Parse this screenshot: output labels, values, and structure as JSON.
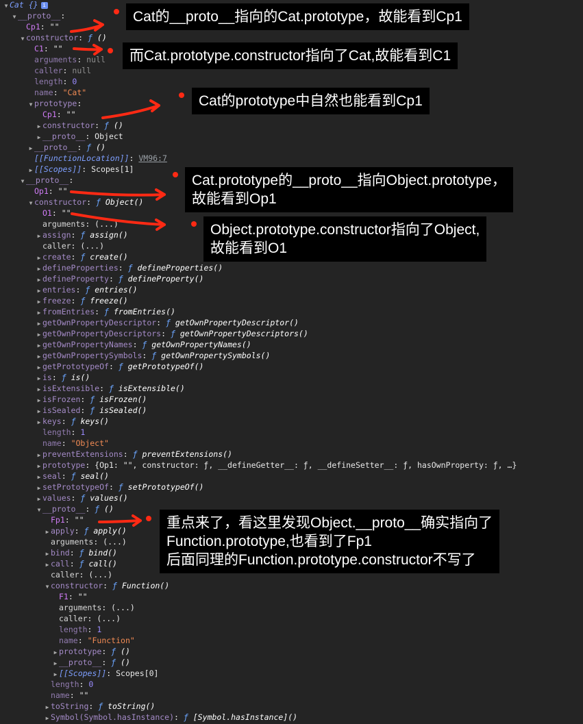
{
  "tree": [
    {
      "lvl": 0,
      "tri": "open",
      "key": "Cat {}",
      "kc": "k-int",
      "info": "i"
    },
    {
      "lvl": 1,
      "tri": "open",
      "key": "__proto__",
      "kc": "k-inh"
    },
    {
      "lvl": 2,
      "tri": "",
      "key": "Cp1",
      "kc": "k-own",
      "val": "\"\"",
      "vc": "v-plain"
    },
    {
      "lvl": 2,
      "tri": "open",
      "key": "constructor",
      "kc": "k-inh",
      "vf": "ƒ",
      "val": "()",
      "vc": "v-fn"
    },
    {
      "lvl": 3,
      "tri": "",
      "key": "C1",
      "kc": "k-own",
      "val": "\"\"",
      "vc": "v-plain"
    },
    {
      "lvl": 3,
      "tri": "",
      "key": "arguments",
      "kc": "k-faint",
      "val": "null",
      "vc": "v-null"
    },
    {
      "lvl": 3,
      "tri": "",
      "key": "caller",
      "kc": "k-faint",
      "val": "null",
      "vc": "v-null"
    },
    {
      "lvl": 3,
      "tri": "",
      "key": "length",
      "kc": "k-faint",
      "val": "0",
      "vc": "v-num"
    },
    {
      "lvl": 3,
      "tri": "",
      "key": "name",
      "kc": "k-faint",
      "val": "\"Cat\"",
      "vc": "v-str"
    },
    {
      "lvl": 3,
      "tri": "open",
      "key": "prototype",
      "kc": "k-inh"
    },
    {
      "lvl": 4,
      "tri": "",
      "key": "Cp1",
      "kc": "k-own",
      "val": "\"\"",
      "vc": "v-plain"
    },
    {
      "lvl": 4,
      "tri": "closed",
      "key": "constructor",
      "kc": "k-inh",
      "vf": "ƒ",
      "val": "()",
      "vc": "v-fn"
    },
    {
      "lvl": 4,
      "tri": "closed",
      "key": "__proto__",
      "kc": "k-inh",
      "val": "Object",
      "vc": "v-plain"
    },
    {
      "lvl": 3,
      "tri": "closed",
      "key": "__proto__",
      "kc": "k-inh",
      "vf": "ƒ",
      "val": "()",
      "vc": "v-fn"
    },
    {
      "lvl": 3,
      "tri": "",
      "key": "[[FunctionLocation]]",
      "kc": "k-int",
      "val": "VM96:7",
      "vc": "v-link"
    },
    {
      "lvl": 3,
      "tri": "closed",
      "key": "[[Scopes]]",
      "kc": "k-int",
      "val": "Scopes[1]",
      "vc": "v-plain"
    },
    {
      "lvl": 2,
      "tri": "open",
      "key": "__proto__",
      "kc": "k-inh"
    },
    {
      "lvl": 3,
      "tri": "",
      "key": "Op1",
      "kc": "k-own",
      "val": "\"\"",
      "vc": "v-plain"
    },
    {
      "lvl": 3,
      "tri": "open",
      "key": "constructor",
      "kc": "k-inh",
      "vf": "ƒ",
      "val": "Object()",
      "vc": "v-fn"
    },
    {
      "lvl": 4,
      "tri": "",
      "key": "O1",
      "kc": "k-own",
      "val": "\"\"",
      "vc": "v-plain"
    },
    {
      "lvl": 4,
      "tri": "",
      "key": "arguments",
      "kc": "k-pale",
      "val": "(...)",
      "vc": "v-plain"
    },
    {
      "lvl": 4,
      "tri": "closed",
      "key": "assign",
      "kc": "k-inh",
      "vf": "ƒ",
      "val": "assign()",
      "vc": "v-fn"
    },
    {
      "lvl": 4,
      "tri": "",
      "key": "caller",
      "kc": "k-pale",
      "val": "(...)",
      "vc": "v-plain"
    },
    {
      "lvl": 4,
      "tri": "closed",
      "key": "create",
      "kc": "k-inh",
      "vf": "ƒ",
      "val": "create()",
      "vc": "v-fn"
    },
    {
      "lvl": 4,
      "tri": "closed",
      "key": "defineProperties",
      "kc": "k-inh",
      "vf": "ƒ",
      "val": "defineProperties()",
      "vc": "v-fn"
    },
    {
      "lvl": 4,
      "tri": "closed",
      "key": "defineProperty",
      "kc": "k-inh",
      "vf": "ƒ",
      "val": "defineProperty()",
      "vc": "v-fn"
    },
    {
      "lvl": 4,
      "tri": "closed",
      "key": "entries",
      "kc": "k-inh",
      "vf": "ƒ",
      "val": "entries()",
      "vc": "v-fn"
    },
    {
      "lvl": 4,
      "tri": "closed",
      "key": "freeze",
      "kc": "k-inh",
      "vf": "ƒ",
      "val": "freeze()",
      "vc": "v-fn"
    },
    {
      "lvl": 4,
      "tri": "closed",
      "key": "fromEntries",
      "kc": "k-inh",
      "vf": "ƒ",
      "val": "fromEntries()",
      "vc": "v-fn"
    },
    {
      "lvl": 4,
      "tri": "closed",
      "key": "getOwnPropertyDescriptor",
      "kc": "k-inh",
      "vf": "ƒ",
      "val": "getOwnPropertyDescriptor()",
      "vc": "v-fn"
    },
    {
      "lvl": 4,
      "tri": "closed",
      "key": "getOwnPropertyDescriptors",
      "kc": "k-inh",
      "vf": "ƒ",
      "val": "getOwnPropertyDescriptors()",
      "vc": "v-fn"
    },
    {
      "lvl": 4,
      "tri": "closed",
      "key": "getOwnPropertyNames",
      "kc": "k-inh",
      "vf": "ƒ",
      "val": "getOwnPropertyNames()",
      "vc": "v-fn"
    },
    {
      "lvl": 4,
      "tri": "closed",
      "key": "getOwnPropertySymbols",
      "kc": "k-inh",
      "vf": "ƒ",
      "val": "getOwnPropertySymbols()",
      "vc": "v-fn"
    },
    {
      "lvl": 4,
      "tri": "closed",
      "key": "getPrototypeOf",
      "kc": "k-inh",
      "vf": "ƒ",
      "val": "getPrototypeOf()",
      "vc": "v-fn"
    },
    {
      "lvl": 4,
      "tri": "closed",
      "key": "is",
      "kc": "k-inh",
      "vf": "ƒ",
      "val": "is()",
      "vc": "v-fn"
    },
    {
      "lvl": 4,
      "tri": "closed",
      "key": "isExtensible",
      "kc": "k-inh",
      "vf": "ƒ",
      "val": "isExtensible()",
      "vc": "v-fn"
    },
    {
      "lvl": 4,
      "tri": "closed",
      "key": "isFrozen",
      "kc": "k-inh",
      "vf": "ƒ",
      "val": "isFrozen()",
      "vc": "v-fn"
    },
    {
      "lvl": 4,
      "tri": "closed",
      "key": "isSealed",
      "kc": "k-inh",
      "vf": "ƒ",
      "val": "isSealed()",
      "vc": "v-fn"
    },
    {
      "lvl": 4,
      "tri": "closed",
      "key": "keys",
      "kc": "k-inh",
      "vf": "ƒ",
      "val": "keys()",
      "vc": "v-fn"
    },
    {
      "lvl": 4,
      "tri": "",
      "key": "length",
      "kc": "k-faint",
      "val": "1",
      "vc": "v-num"
    },
    {
      "lvl": 4,
      "tri": "",
      "key": "name",
      "kc": "k-faint",
      "val": "\"Object\"",
      "vc": "v-str"
    },
    {
      "lvl": 4,
      "tri": "closed",
      "key": "preventExtensions",
      "kc": "k-inh",
      "vf": "ƒ",
      "val": "preventExtensions()",
      "vc": "v-fn"
    },
    {
      "lvl": 4,
      "tri": "closed",
      "key": "prototype",
      "kc": "k-inh",
      "val": "{Op1: \"\", constructor: ƒ, __defineGetter__: ƒ, __defineSetter__: ƒ, hasOwnProperty: ƒ, …}",
      "vc": "v-plain"
    },
    {
      "lvl": 4,
      "tri": "closed",
      "key": "seal",
      "kc": "k-inh",
      "vf": "ƒ",
      "val": "seal()",
      "vc": "v-fn"
    },
    {
      "lvl": 4,
      "tri": "closed",
      "key": "setPrototypeOf",
      "kc": "k-inh",
      "vf": "ƒ",
      "val": "setPrototypeOf()",
      "vc": "v-fn"
    },
    {
      "lvl": 4,
      "tri": "closed",
      "key": "values",
      "kc": "k-inh",
      "vf": "ƒ",
      "val": "values()",
      "vc": "v-fn"
    },
    {
      "lvl": 4,
      "tri": "open",
      "key": "__proto__",
      "kc": "k-inh",
      "vf": "ƒ",
      "val": "()",
      "vc": "v-fn"
    },
    {
      "lvl": 5,
      "tri": "",
      "key": "Fp1",
      "kc": "k-own",
      "val": "\"\"",
      "vc": "v-plain"
    },
    {
      "lvl": 5,
      "tri": "closed",
      "key": "apply",
      "kc": "k-inh",
      "vf": "ƒ",
      "val": "apply()",
      "vc": "v-fn"
    },
    {
      "lvl": 5,
      "tri": "",
      "key": "arguments",
      "kc": "k-pale",
      "val": "(...)",
      "vc": "v-plain"
    },
    {
      "lvl": 5,
      "tri": "closed",
      "key": "bind",
      "kc": "k-inh",
      "vf": "ƒ",
      "val": "bind()",
      "vc": "v-fn"
    },
    {
      "lvl": 5,
      "tri": "closed",
      "key": "call",
      "kc": "k-inh",
      "vf": "ƒ",
      "val": "call()",
      "vc": "v-fn"
    },
    {
      "lvl": 5,
      "tri": "",
      "key": "caller",
      "kc": "k-pale",
      "val": "(...)",
      "vc": "v-plain"
    },
    {
      "lvl": 5,
      "tri": "open",
      "key": "constructor",
      "kc": "k-inh",
      "vf": "ƒ",
      "val": "Function()",
      "vc": "v-fn"
    },
    {
      "lvl": 6,
      "tri": "",
      "key": "F1",
      "kc": "k-own",
      "val": "\"\"",
      "vc": "v-plain"
    },
    {
      "lvl": 6,
      "tri": "",
      "key": "arguments",
      "kc": "k-pale",
      "val": "(...)",
      "vc": "v-plain"
    },
    {
      "lvl": 6,
      "tri": "",
      "key": "caller",
      "kc": "k-pale",
      "val": "(...)",
      "vc": "v-plain"
    },
    {
      "lvl": 6,
      "tri": "",
      "key": "length",
      "kc": "k-faint",
      "val": "1",
      "vc": "v-num"
    },
    {
      "lvl": 6,
      "tri": "",
      "key": "name",
      "kc": "k-faint",
      "val": "\"Function\"",
      "vc": "v-str"
    },
    {
      "lvl": 6,
      "tri": "closed",
      "key": "prototype",
      "kc": "k-inh",
      "vf": "ƒ",
      "val": "()",
      "vc": "v-fn"
    },
    {
      "lvl": 6,
      "tri": "closed",
      "key": "__proto__",
      "kc": "k-inh",
      "vf": "ƒ",
      "val": "()",
      "vc": "v-fn"
    },
    {
      "lvl": 6,
      "tri": "closed",
      "key": "[[Scopes]]",
      "kc": "k-int",
      "val": "Scopes[0]",
      "vc": "v-plain"
    },
    {
      "lvl": 5,
      "tri": "",
      "key": "length",
      "kc": "k-faint",
      "val": "0",
      "vc": "v-num"
    },
    {
      "lvl": 5,
      "tri": "",
      "key": "name",
      "kc": "k-faint",
      "val": "\"\"",
      "vc": "v-plain"
    },
    {
      "lvl": 5,
      "tri": "closed",
      "key": "toString",
      "kc": "k-inh",
      "vf": "ƒ",
      "val": "toString()",
      "vc": "v-fn"
    },
    {
      "lvl": 5,
      "tri": "closed",
      "key": "Symbol(Symbol.hasInstance)",
      "kc": "k-inh",
      "vf": "ƒ",
      "val": "[Symbol.hasInstance]()",
      "vc": "v-fn"
    }
  ],
  "notes": {
    "n1": [
      "Cat的__proto__指向的Cat.prototype，故能看到Cp1"
    ],
    "n2": [
      "而Cat.prototype.constructor指向了Cat,故能看到C1"
    ],
    "n3": [
      "Cat的prototype中自然也能看到Cp1"
    ],
    "n4": [
      "Cat.prototype的__proto__指向Object.prototype，",
      "故能看到Op1"
    ],
    "n5": [
      "Object.prototype.constructor指向了Object,",
      "故能看到O1"
    ],
    "n6": [
      "重点来了，看这里发现Object.__proto__确实指向了",
      "Function.prototype,也看到了Fp1",
      "后面同理的Function.prototype.constructor不写了"
    ]
  },
  "colors": {
    "background": "#242424",
    "annotation_bg": "#000000",
    "arrow": "#ff2a14",
    "own_key": "#cf7bf5",
    "inherited_key": "#a58bc8",
    "string_value": "#f28b54",
    "number_value": "#9b8cff",
    "function_marker": "#6ca6ff"
  },
  "icons": {
    "expanded": "triangle-down-icon",
    "collapsed": "triangle-right-icon",
    "info": "info-icon",
    "annotation_marker": "red-dot-icon",
    "annotation_arrow": "red-arrow-icon"
  }
}
